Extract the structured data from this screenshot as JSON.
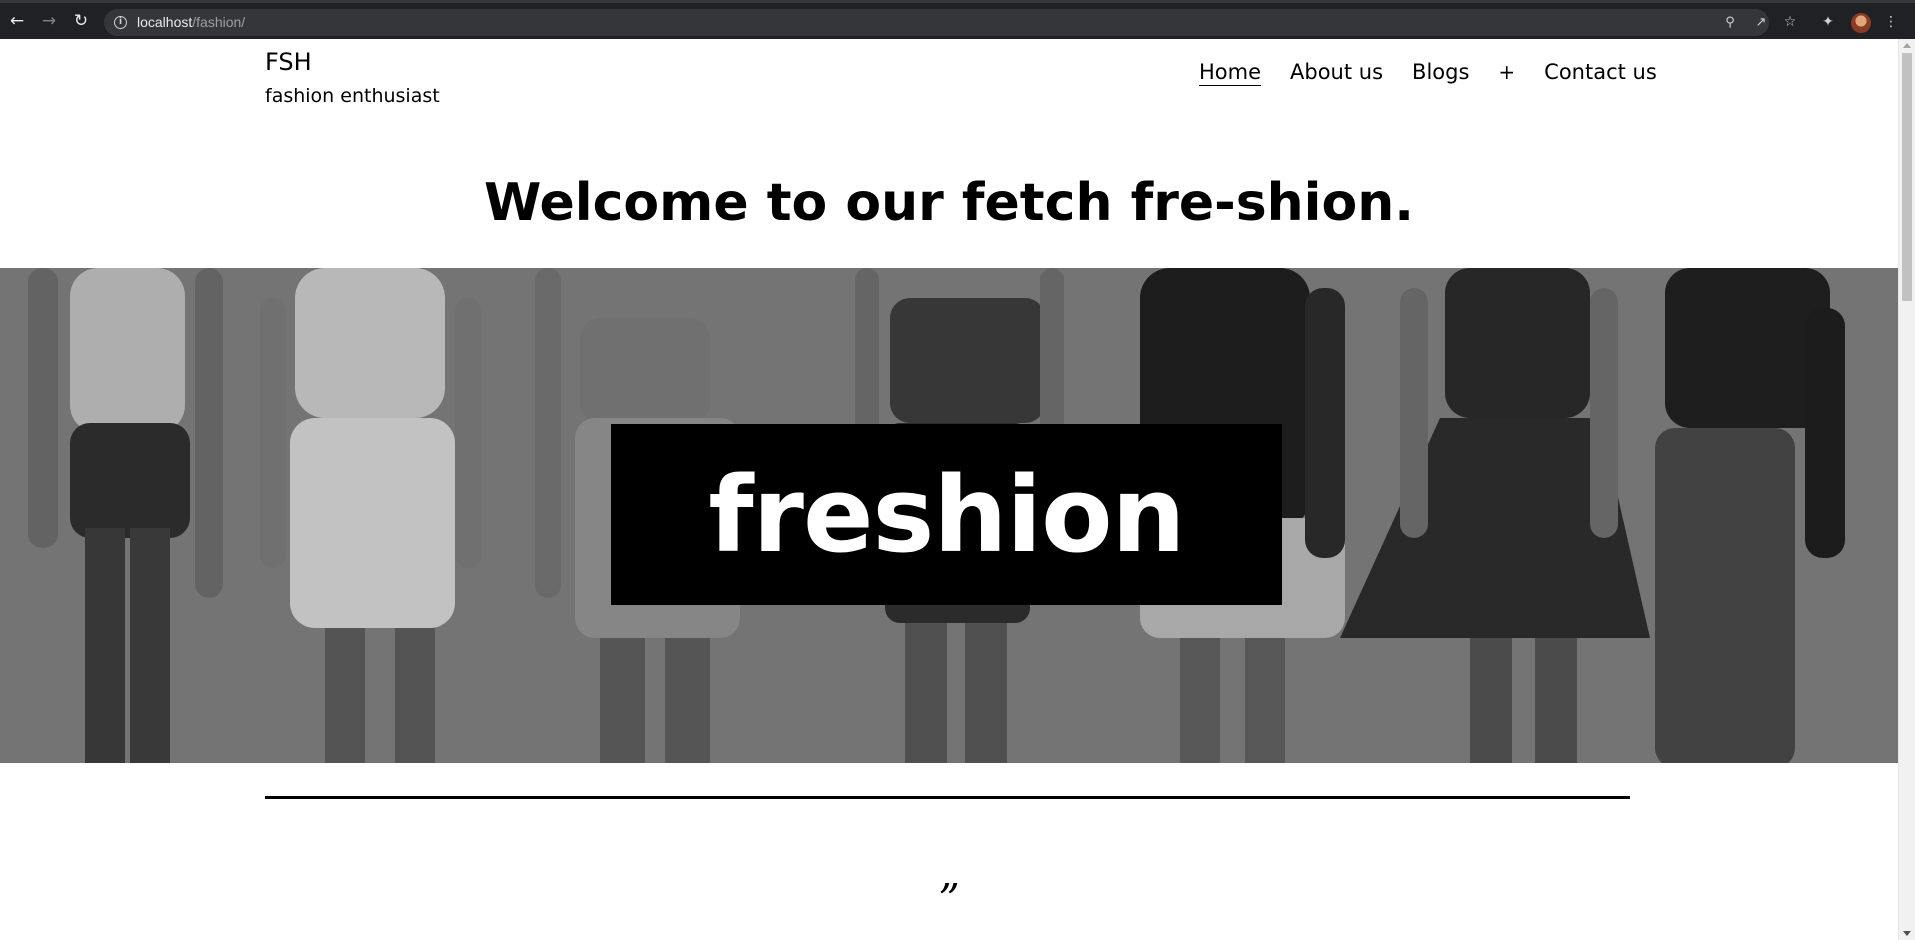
{
  "browser": {
    "back_icon": "arrow-left-icon",
    "forward_icon": "arrow-right-icon",
    "reload_icon": "reload-icon",
    "url_host": "localhost",
    "url_path": "/fashion/"
  },
  "site": {
    "title": "FSH",
    "tagline": "fashion enthusiast"
  },
  "nav": {
    "items": [
      {
        "label": "Home"
      },
      {
        "label": "About us"
      },
      {
        "label": "Blogs"
      },
      {
        "label": "+"
      },
      {
        "label": "Contact us"
      }
    ]
  },
  "main": {
    "welcome": "Welcome to our fetch fre-shion.",
    "hero_text": "freshion",
    "quote_mark": "”"
  }
}
